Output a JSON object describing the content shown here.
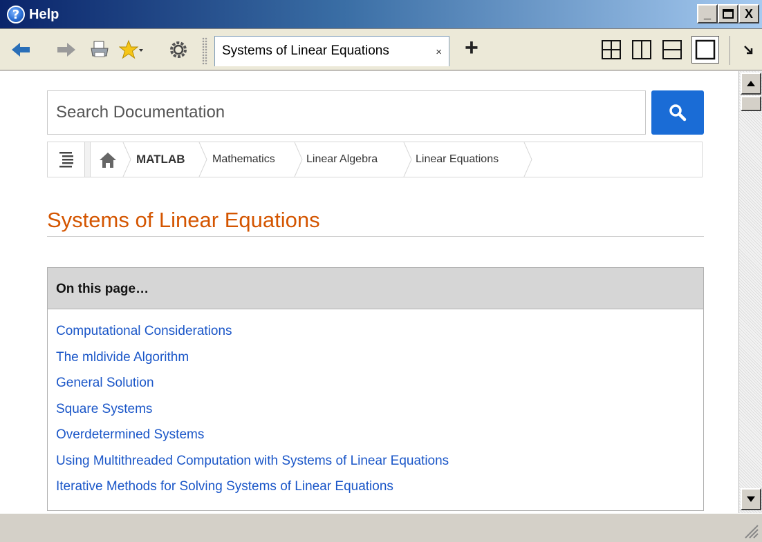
{
  "window": {
    "title": "Help",
    "minimize": "_",
    "close": "X"
  },
  "toolbar": {
    "tab_label": "Systems of Linear Equations",
    "tab_close": "×",
    "new_tab": "+"
  },
  "search": {
    "placeholder": "Search Documentation"
  },
  "breadcrumbs": [
    {
      "label": "MATLAB"
    },
    {
      "label": "Mathematics"
    },
    {
      "label": "Linear Algebra"
    },
    {
      "label": "Linear Equations"
    }
  ],
  "page": {
    "title": "Systems of Linear Equations"
  },
  "toc": {
    "heading": "On this page…",
    "items": [
      "Computational Considerations",
      "The mldivide Algorithm",
      "General Solution",
      "Square Systems",
      "Overdetermined Systems",
      "Using Multithreaded Computation with Systems of Linear Equations",
      "Iterative Methods for Solving Systems of Linear Equations"
    ]
  },
  "colors": {
    "title_accent": "#d45500",
    "link": "#1a56c8",
    "search_button": "#1a6cd6"
  }
}
